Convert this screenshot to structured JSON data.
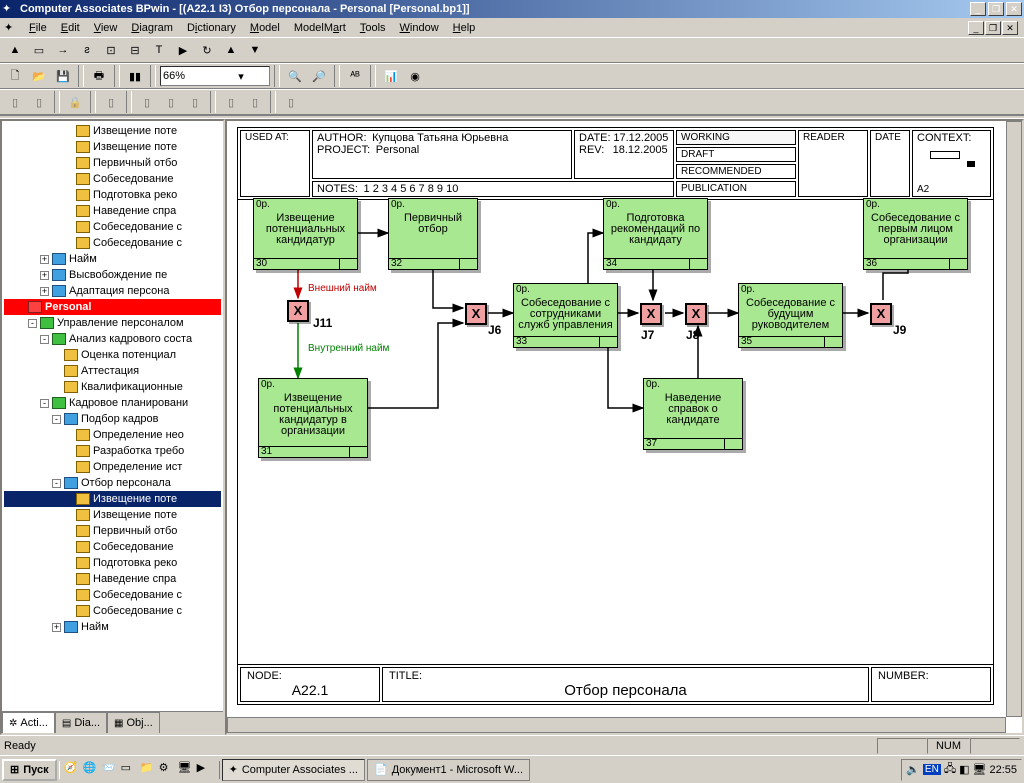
{
  "window": {
    "title": "Computer Associates BPwin - [(A22.1 I3) Отбор персонала - Personal  [Personal.bp1]]"
  },
  "menu": [
    "File",
    "Edit",
    "View",
    "Diagram",
    "Dictionary",
    "Model",
    "ModelMart",
    "Tools",
    "Window",
    "Help"
  ],
  "zoom": "66%",
  "tree": {
    "items": [
      {
        "ind": 5,
        "ic": "y",
        "t": "Извещение поте"
      },
      {
        "ind": 5,
        "ic": "y",
        "t": "Извещение поте"
      },
      {
        "ind": 5,
        "ic": "y",
        "t": "Первичный отбо"
      },
      {
        "ind": 5,
        "ic": "y",
        "t": "Собеседование"
      },
      {
        "ind": 5,
        "ic": "y",
        "t": "Подготовка реко"
      },
      {
        "ind": 5,
        "ic": "y",
        "t": "Наведение спра"
      },
      {
        "ind": 5,
        "ic": "y",
        "t": "Собеседование с"
      },
      {
        "ind": 5,
        "ic": "y",
        "t": "Собеседование с"
      },
      {
        "ind": 3,
        "ic": "b",
        "t": "Найм",
        "exp": "+"
      },
      {
        "ind": 3,
        "ic": "b",
        "t": "Высвобождение пе",
        "exp": "+"
      },
      {
        "ind": 3,
        "ic": "b",
        "t": "Адаптация персона",
        "exp": "+"
      },
      {
        "ind": 1,
        "ic": "r",
        "t": "Personal",
        "selred": true
      },
      {
        "ind": 2,
        "ic": "g",
        "t": "Управление персоналом",
        "exp": "-"
      },
      {
        "ind": 3,
        "ic": "g",
        "t": "Анализ кадрового соста",
        "exp": "-"
      },
      {
        "ind": 4,
        "ic": "y",
        "t": "Оценка потенциал"
      },
      {
        "ind": 4,
        "ic": "y",
        "t": "Аттестация"
      },
      {
        "ind": 4,
        "ic": "y",
        "t": "Квалификационные"
      },
      {
        "ind": 3,
        "ic": "g",
        "t": "Кадровое планировани",
        "exp": "-"
      },
      {
        "ind": 4,
        "ic": "b",
        "t": "Подбор кадров",
        "exp": "-"
      },
      {
        "ind": 5,
        "ic": "y",
        "t": "Определение нео"
      },
      {
        "ind": 5,
        "ic": "y",
        "t": "Разработка требо"
      },
      {
        "ind": 5,
        "ic": "y",
        "t": "Определение ист"
      },
      {
        "ind": 4,
        "ic": "b",
        "t": "Отбор персонала",
        "exp": "-"
      },
      {
        "ind": 5,
        "ic": "y",
        "t": "Извещение поте",
        "sel": true
      },
      {
        "ind": 5,
        "ic": "y",
        "t": "Извещение поте"
      },
      {
        "ind": 5,
        "ic": "y",
        "t": "Первичный отбо"
      },
      {
        "ind": 5,
        "ic": "y",
        "t": "Собеседование"
      },
      {
        "ind": 5,
        "ic": "y",
        "t": "Подготовка реко"
      },
      {
        "ind": 5,
        "ic": "y",
        "t": "Наведение спра"
      },
      {
        "ind": 5,
        "ic": "y",
        "t": "Собеседование с"
      },
      {
        "ind": 5,
        "ic": "y",
        "t": "Собеседование с"
      },
      {
        "ind": 4,
        "ic": "b",
        "t": "Найм",
        "exp": "+"
      }
    ]
  },
  "tabs": {
    "acti": "Acti...",
    "dia": "Dia...",
    "obj": "Obj..."
  },
  "header": {
    "used_at": "USED AT:",
    "author_l": "AUTHOR:",
    "author": "Купцова Татьяна Юрьевна",
    "project_l": "PROJECT:",
    "project": "Personal",
    "notes_l": "NOTES:",
    "notes": "1  2  3  4  5  6  7  8  9  10",
    "date_l": "DATE:",
    "date": "17.12.2005",
    "rev_l": "REV:",
    "rev": "18.12.2005",
    "working": "WORKING",
    "draft": "DRAFT",
    "recommended": "RECOMMENDED",
    "publication": "PUBLICATION",
    "reader": "READER",
    "rdate": "DATE",
    "context": "CONTEXT:",
    "ctxid": "A2"
  },
  "footer": {
    "node_l": "NODE:",
    "node": "A22.1",
    "title_l": "TITLE:",
    "title": "Отбор персонала",
    "number_l": "NUMBER:"
  },
  "activities": {
    "a30": {
      "pre": "0р.",
      "txt": "Извещение потенциальных кандидатур",
      "num": "30"
    },
    "a31": {
      "pre": "0р.",
      "txt": "Извещение потенциальных кандидатур в организации",
      "num": "31"
    },
    "a32": {
      "pre": "0р.",
      "txt": "Первичный отбор",
      "num": "32"
    },
    "a33": {
      "pre": "0р.",
      "txt": "Собеседование с сотрудниками служб управления",
      "num": "33"
    },
    "a34": {
      "pre": "0р.",
      "txt": "Подготовка рекомендаций по кандидату",
      "num": "34"
    },
    "a37": {
      "pre": "0р.",
      "txt": "Наведение справок о кандидате",
      "num": "37"
    },
    "a35": {
      "pre": "0р.",
      "txt": "Собеседование с будущим руководителем",
      "num": "35"
    },
    "a36": {
      "pre": "0р.",
      "txt": "Собеседование с первым лицом организации",
      "num": "36"
    }
  },
  "junctions": {
    "j11": "J11",
    "j6": "J6",
    "j7": "J7",
    "j8": "J8",
    "j9": "J9",
    "x": "X"
  },
  "flowlabels": {
    "ext": "Внешний найм",
    "int": "Внутренний найм"
  },
  "status": {
    "ready": "Ready",
    "num": "NUM"
  },
  "taskbar": {
    "start": "Пуск",
    "btn1": "Computer Associates ...",
    "btn2": "Документ1 - Microsoft W...",
    "clock": "22:55"
  }
}
